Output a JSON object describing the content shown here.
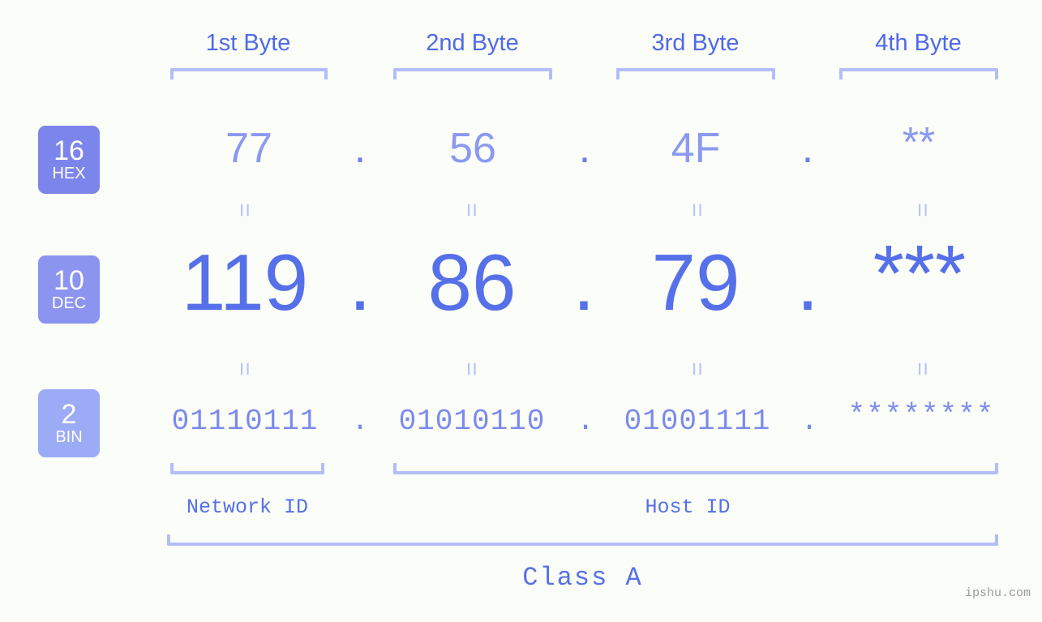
{
  "meta": {
    "background_color": "#fbfdf9",
    "accent_color": "#5570e8",
    "light_accent_color": "#b4bdfa",
    "watermark": "ipshu.com"
  },
  "byte_headers": [
    {
      "label": "1st Byte"
    },
    {
      "label": "2nd Byte"
    },
    {
      "label": "3rd Byte"
    },
    {
      "label": "4th Byte"
    }
  ],
  "bases": [
    {
      "number": "16",
      "name": "HEX",
      "color": "#7b85ec"
    },
    {
      "number": "10",
      "name": "DEC",
      "color": "#8b95f0"
    },
    {
      "number": "2",
      "name": "BIN",
      "color": "#9babf5"
    }
  ],
  "rows": {
    "hex": {
      "values": [
        "77",
        "56",
        "4F",
        "**"
      ],
      "separator": "."
    },
    "dec": {
      "values": [
        "119",
        "86",
        "79",
        "***"
      ],
      "separator": "."
    },
    "bin": {
      "values": [
        "01110111",
        "01010110",
        "01001111",
        "********"
      ],
      "separator": "."
    }
  },
  "equivalence_marker": "=",
  "segments": {
    "network_id": "Network ID",
    "host_id": "Host ID",
    "class": "Class A"
  }
}
